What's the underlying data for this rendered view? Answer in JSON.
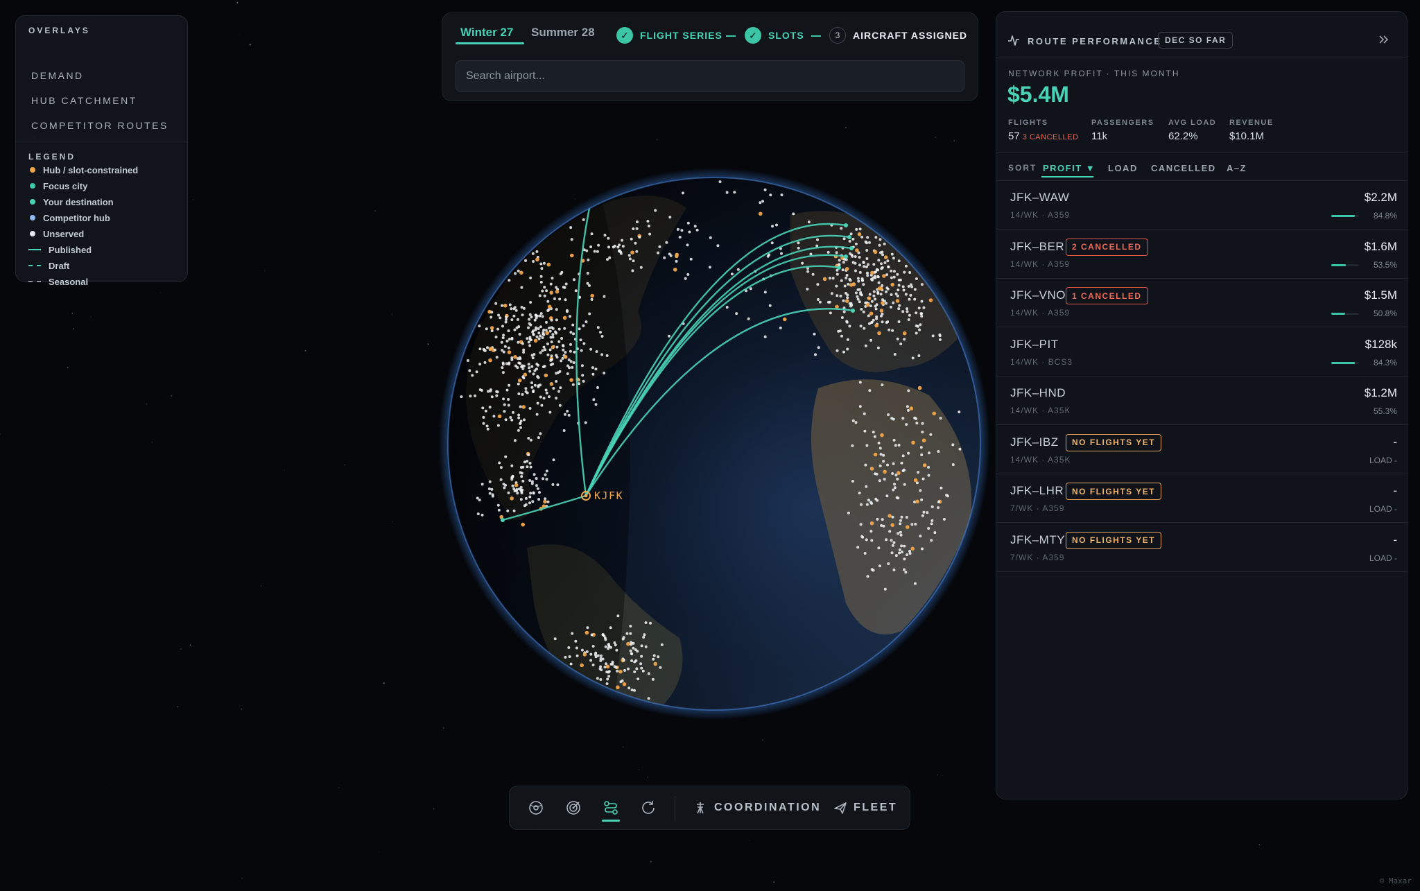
{
  "overlays": {
    "title": "OVERLAYS",
    "items": [
      "DEMAND",
      "HUB CATCHMENT",
      "COMPETITOR ROUTES"
    ]
  },
  "legend": {
    "title": "LEGEND",
    "items": [
      {
        "label": "Hub / slot-constrained",
        "kind": "dot",
        "color": "#f0a54a"
      },
      {
        "label": "Focus city",
        "kind": "dot",
        "color": "#3cc6a6"
      },
      {
        "label": "Your destination",
        "kind": "dot",
        "color": "#49d3b6"
      },
      {
        "label": "Competitor hub",
        "kind": "dot",
        "color": "#8fb8f0"
      },
      {
        "label": "Unserved",
        "kind": "dot",
        "color": "#e6e9ec"
      },
      {
        "label": "Published",
        "kind": "solid",
        "color": "#49d3b6"
      },
      {
        "label": "Draft",
        "kind": "dashed",
        "color": "#49d3b6"
      },
      {
        "label": "Seasonal",
        "kind": "dashed-gray",
        "color": "#8d969f"
      }
    ]
  },
  "seasons": {
    "tabs": [
      "Winter 27",
      "Summer 28"
    ],
    "active": "Winter 27"
  },
  "steps": [
    {
      "label": "FLIGHT SERIES",
      "state": "done"
    },
    {
      "label": "SLOTS",
      "state": "done"
    },
    {
      "label": "AIRCRAFT ASSIGNED",
      "state": "pending",
      "number": "3"
    }
  ],
  "search": {
    "placeholder": "Search airport..."
  },
  "globe": {
    "hub_label": "KJFK",
    "colors": {
      "route": "#49d3b6",
      "hub": "#f0a54a",
      "airport": "#f2f4f6"
    }
  },
  "toolbar": {
    "icons": [
      "globe-view-icon",
      "target-icon",
      "routes-icon",
      "refresh-icon"
    ],
    "coordination_label": "COORDINATION",
    "fleet_label": "FLEET"
  },
  "panel": {
    "title": "ROUTE PERFORMANCE",
    "badge": "DEC SO FAR",
    "network_profit_label": "NETWORK PROFIT · THIS MONTH",
    "network_profit_value": "$5.4M",
    "stats": [
      {
        "label": "FLIGHTS",
        "value": "57",
        "extra": "3 CANCELLED"
      },
      {
        "label": "PASSENGERS",
        "value": "11k"
      },
      {
        "label": "AVG LOAD",
        "value": "62.2%"
      },
      {
        "label": "REVENUE",
        "value": "$10.1M"
      }
    ],
    "sort": {
      "label": "SORT",
      "options": [
        "PROFIT ▼",
        "LOAD",
        "CANCELLED",
        "A–Z"
      ],
      "active": "PROFIT ▼"
    },
    "routes": [
      {
        "name": "JFK–WAW",
        "sub": "14/WK · A359",
        "profit": "$2.2M",
        "load": "84.8%",
        "load_fraction": 0.848,
        "badge": "",
        "badge_kind": ""
      },
      {
        "name": "JFK–BER",
        "sub": "14/WK · A359",
        "profit": "$1.6M",
        "load": "53.5%",
        "load_fraction": 0.535,
        "badge": "2 CANCELLED",
        "badge_kind": "red"
      },
      {
        "name": "JFK–VNO",
        "sub": "14/WK · A359",
        "profit": "$1.5M",
        "load": "50.8%",
        "load_fraction": 0.508,
        "badge": "1 CANCELLED",
        "badge_kind": "red"
      },
      {
        "name": "JFK–PIT",
        "sub": "14/WK · BCS3",
        "profit": "$128k",
        "load": "84.3%",
        "load_fraction": 0.843,
        "badge": "",
        "badge_kind": ""
      },
      {
        "name": "JFK–HND",
        "sub": "14/WK · A35K",
        "profit": "$1.2M",
        "load": "55.3%",
        "load_fraction": 0,
        "badge": "",
        "badge_kind": ""
      },
      {
        "name": "JFK–IBZ",
        "sub": "14/WK · A35K",
        "profit": "-",
        "load": "LOAD -",
        "load_fraction": 0,
        "badge": "NO FLIGHTS YET",
        "badge_kind": "amber"
      },
      {
        "name": "JFK–LHR",
        "sub": "7/WK · A359",
        "profit": "-",
        "load": "LOAD -",
        "load_fraction": 0,
        "badge": "NO FLIGHTS YET",
        "badge_kind": "amber"
      },
      {
        "name": "JFK–MTY",
        "sub": "7/WK · A359",
        "profit": "-",
        "load": "LOAD -",
        "load_fraction": 0,
        "badge": "NO FLIGHTS YET",
        "badge_kind": "amber"
      }
    ]
  },
  "attribution": "© Maxar"
}
